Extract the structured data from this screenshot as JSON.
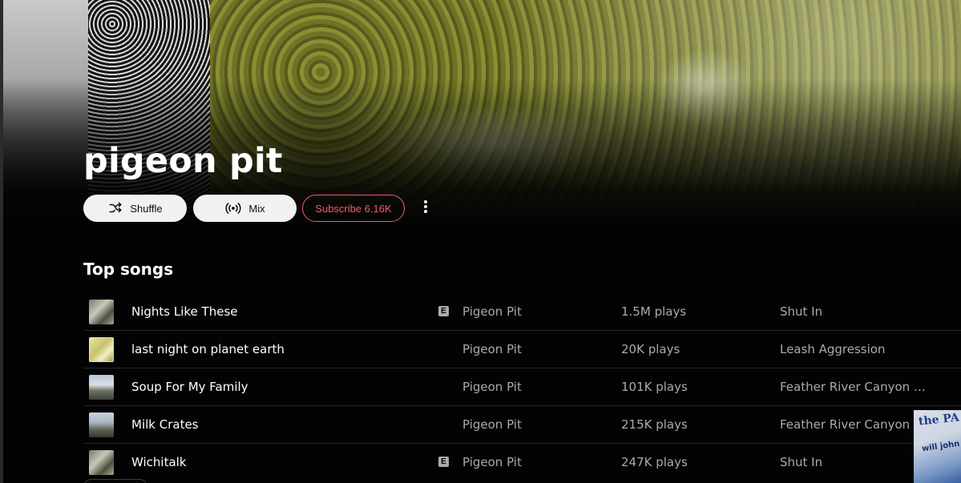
{
  "artist": {
    "name": "pigeon pit"
  },
  "actions": {
    "shuffle_label": "Shuffle",
    "mix_label": "Mix",
    "subscribe_label": "Subscribe 6.16K"
  },
  "top_songs": {
    "title": "Top songs",
    "items": [
      {
        "title": "Nights Like These",
        "explicit": true,
        "explicit_badge": "E",
        "artist": "Pigeon Pit",
        "plays": "1.5M plays",
        "album": "Shut In"
      },
      {
        "title": "last night on planet earth",
        "explicit": false,
        "explicit_badge": "",
        "artist": "Pigeon Pit",
        "plays": "20K plays",
        "album": "Leash Aggression"
      },
      {
        "title": "Soup For My Family",
        "explicit": false,
        "explicit_badge": "",
        "artist": "Pigeon Pit",
        "plays": "101K plays",
        "album": "Feather River Canyon Blues"
      },
      {
        "title": "Milk Crates",
        "explicit": false,
        "explicit_badge": "",
        "artist": "Pigeon Pit",
        "plays": "215K plays",
        "album": "Feather River Canyon Blues"
      },
      {
        "title": "Wichitalk",
        "explicit": true,
        "explicit_badge": "E",
        "artist": "Pigeon Pit",
        "plays": "247K plays",
        "album": "Shut In"
      }
    ]
  },
  "corner_card": {
    "line1": "the PA",
    "line2": "will john"
  },
  "colors": {
    "background": "#030303",
    "subscribe_accent": "#f05a68",
    "secondary_text": "#aaaaaa",
    "button_light": "#f1f1f1"
  },
  "icons": {
    "shuffle": "shuffle-icon",
    "mix": "radio-broadcast-icon",
    "more": "more-vertical-icon",
    "explicit": "explicit-icon"
  }
}
